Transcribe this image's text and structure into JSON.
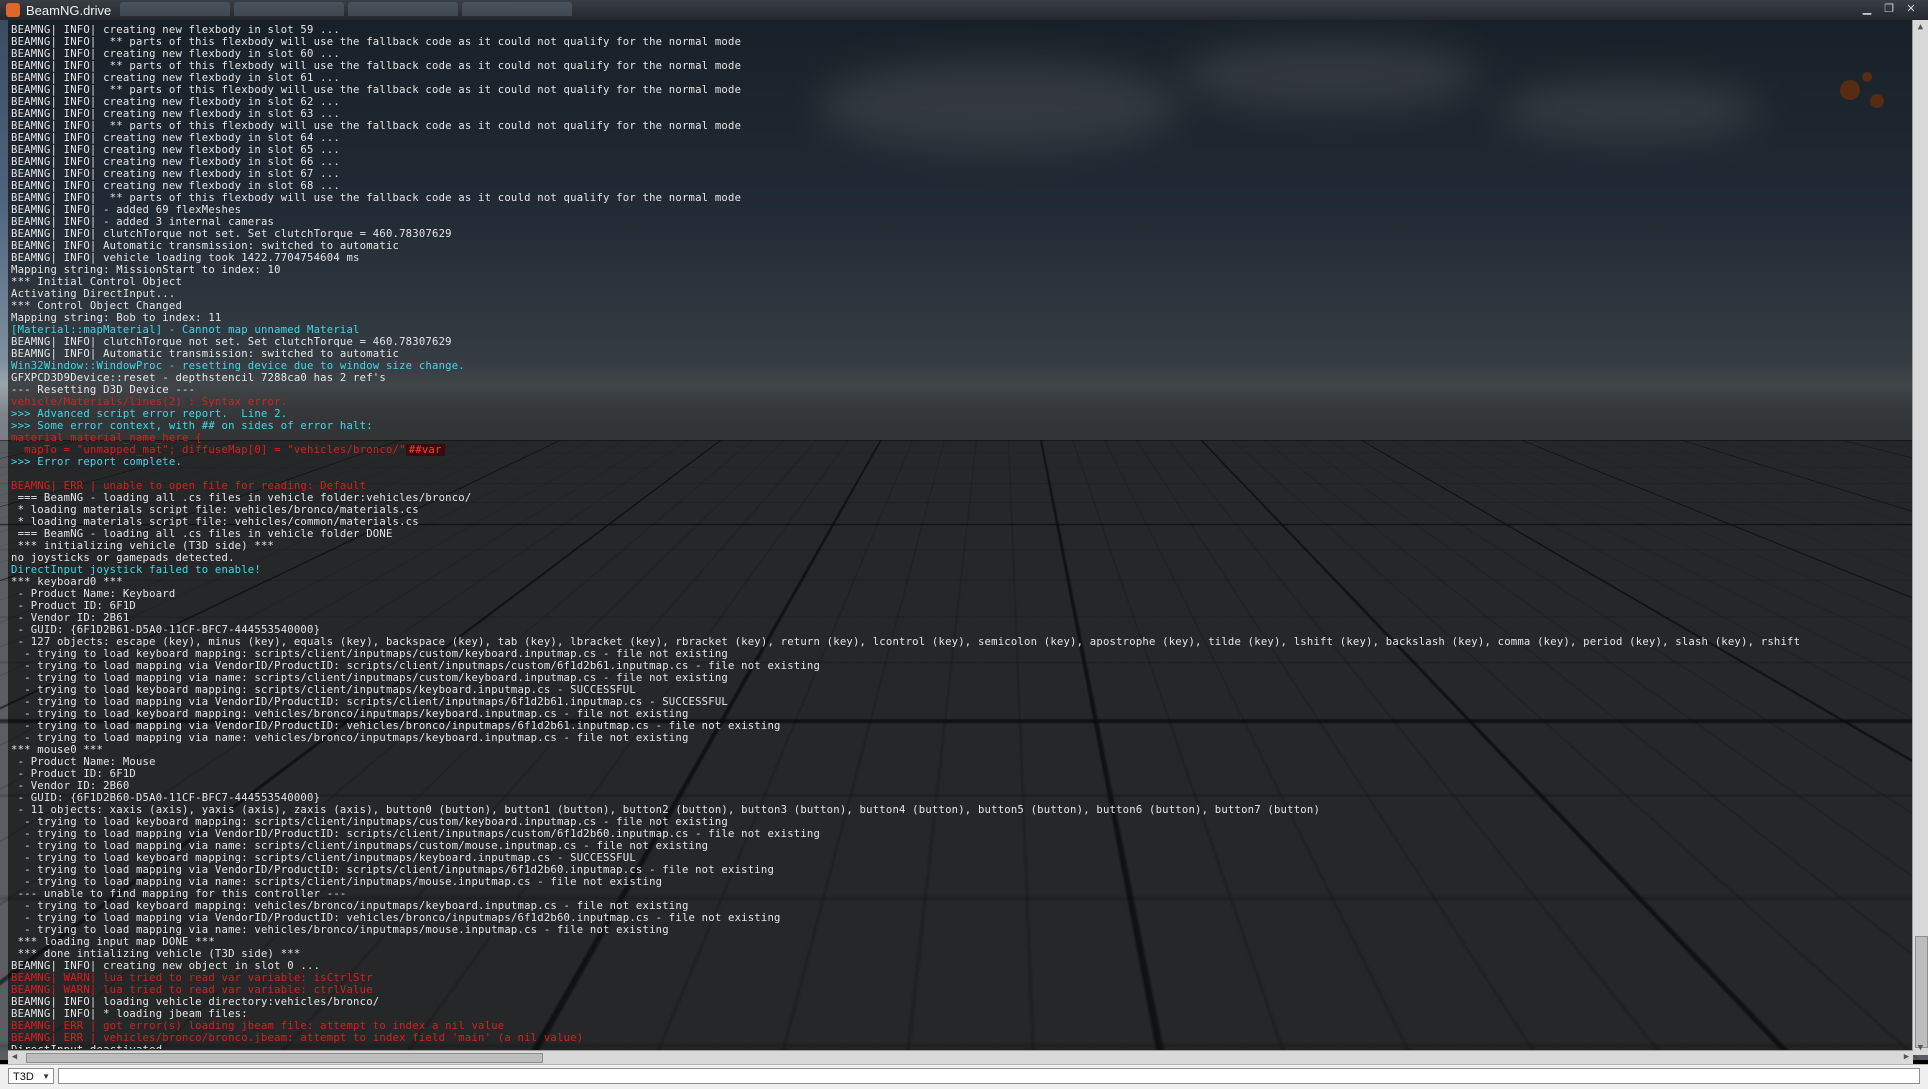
{
  "window": {
    "title": "BeamNG.drive"
  },
  "console": {
    "lines": [
      {
        "cls": "info",
        "text": "BEAMNG| INFO| creating new flexbody in slot 59 ..."
      },
      {
        "cls": "info",
        "text": "BEAMNG| INFO|  ** parts of this flexbody will use the fallback code as it could not qualify for the normal mode"
      },
      {
        "cls": "info",
        "text": "BEAMNG| INFO| creating new flexbody in slot 60 ..."
      },
      {
        "cls": "info",
        "text": "BEAMNG| INFO|  ** parts of this flexbody will use the fallback code as it could not qualify for the normal mode"
      },
      {
        "cls": "info",
        "text": "BEAMNG| INFO| creating new flexbody in slot 61 ..."
      },
      {
        "cls": "info",
        "text": "BEAMNG| INFO|  ** parts of this flexbody will use the fallback code as it could not qualify for the normal mode"
      },
      {
        "cls": "info",
        "text": "BEAMNG| INFO| creating new flexbody in slot 62 ..."
      },
      {
        "cls": "info",
        "text": "BEAMNG| INFO| creating new flexbody in slot 63 ..."
      },
      {
        "cls": "info",
        "text": "BEAMNG| INFO|  ** parts of this flexbody will use the fallback code as it could not qualify for the normal mode"
      },
      {
        "cls": "info",
        "text": "BEAMNG| INFO| creating new flexbody in slot 64 ..."
      },
      {
        "cls": "info",
        "text": "BEAMNG| INFO| creating new flexbody in slot 65 ..."
      },
      {
        "cls": "info",
        "text": "BEAMNG| INFO| creating new flexbody in slot 66 ..."
      },
      {
        "cls": "info",
        "text": "BEAMNG| INFO| creating new flexbody in slot 67 ..."
      },
      {
        "cls": "info",
        "text": "BEAMNG| INFO| creating new flexbody in slot 68 ..."
      },
      {
        "cls": "info",
        "text": "BEAMNG| INFO|  ** parts of this flexbody will use the fallback code as it could not qualify for the normal mode"
      },
      {
        "cls": "info",
        "text": "BEAMNG| INFO| - added 69 flexMeshes"
      },
      {
        "cls": "info",
        "text": "BEAMNG| INFO| - added 3 internal cameras"
      },
      {
        "cls": "info",
        "text": "BEAMNG| INFO| clutchTorque not set. Set clutchTorque = 460.78307629"
      },
      {
        "cls": "info",
        "text": "BEAMNG| INFO| Automatic transmission: switched to automatic"
      },
      {
        "cls": "info",
        "text": "BEAMNG| INFO| vehicle loading took 1422.7704754604 ms"
      },
      {
        "cls": "info",
        "text": "Mapping string: MissionStart to index: 10"
      },
      {
        "cls": "info",
        "text": "*** Initial Control Object"
      },
      {
        "cls": "info",
        "text": "Activating DirectInput..."
      },
      {
        "cls": "info",
        "text": "*** Control Object Changed"
      },
      {
        "cls": "info",
        "text": "Mapping string: Bob to index: 11"
      },
      {
        "cls": "cyan",
        "text": "[Material::mapMaterial] - Cannot map unnamed Material"
      },
      {
        "cls": "info",
        "text": "BEAMNG| INFO| clutchTorque not set. Set clutchTorque = 460.78307629"
      },
      {
        "cls": "info",
        "text": "BEAMNG| INFO| Automatic transmission: switched to automatic"
      },
      {
        "cls": "cyan",
        "text": "Win32Window::WindowProc - resetting device due to window size change."
      },
      {
        "cls": "info",
        "text": "GFXPCD3D9Device::reset - depthstencil 7288ca0 has 2 ref's"
      },
      {
        "cls": "info",
        "text": "--- Resetting D3D Device ---"
      },
      {
        "cls": "red",
        "text": "vehicle/Materials/lines(2) : Syntax error."
      },
      {
        "cls": "cyan",
        "text": ">>> Advanced script error report.  Line 2."
      },
      {
        "cls": "cyan",
        "text": ">>> Some error context, with ## on sides of error halt:"
      },
      {
        "cls": "red",
        "text": "material material_name_here {"
      },
      {
        "cls": "red",
        "text": "  mapTo = \"unmapped_mat\"; diffuseMap[0] = \"vehicles/bronco/\"",
        "hl": "##var"
      },
      {
        "cls": "cyan",
        "text": ">>> Error report complete."
      },
      {
        "cls": "info",
        "text": ""
      },
      {
        "cls": "red",
        "text": "BEAMNG| ERR | unable to open file for reading: Default"
      },
      {
        "cls": "info",
        "text": " === BeamNG - loading all .cs files in vehicle folder:vehicles/bronco/"
      },
      {
        "cls": "info",
        "text": " * loading materials script file: vehicles/bronco/materials.cs"
      },
      {
        "cls": "info",
        "text": " * loading materials script file: vehicles/common/materials.cs"
      },
      {
        "cls": "info",
        "text": " === BeamNG - loading all .cs files in vehicle folder DONE"
      },
      {
        "cls": "info",
        "text": " *** initializing vehicle (T3D side) ***"
      },
      {
        "cls": "info",
        "text": "no joysticks or gamepads detected."
      },
      {
        "cls": "cyan",
        "text": "DirectInput joystick failed to enable!"
      },
      {
        "cls": "info",
        "text": "*** keyboard0 ***"
      },
      {
        "cls": "info",
        "text": " - Product Name: Keyboard"
      },
      {
        "cls": "info",
        "text": " - Product ID: 6F1D"
      },
      {
        "cls": "info",
        "text": " - Vendor ID: 2B61"
      },
      {
        "cls": "info",
        "text": " - GUID: {6F1D2B61-D5A0-11CF-BFC7-444553540000}"
      },
      {
        "cls": "info",
        "text": " - 127 objects: escape (key), minus (key), equals (key), backspace (key), tab (key), lbracket (key), rbracket (key), return (key), lcontrol (key), semicolon (key), apostrophe (key), tilde (key), lshift (key), backslash (key), comma (key), period (key), slash (key), rshift"
      },
      {
        "cls": "info",
        "text": "  - trying to load keyboard mapping: scripts/client/inputmaps/custom/keyboard.inputmap.cs - file not existing"
      },
      {
        "cls": "info",
        "text": "  - trying to load mapping via VendorID/ProductID: scripts/client/inputmaps/custom/6f1d2b61.inputmap.cs - file not existing"
      },
      {
        "cls": "info",
        "text": "  - trying to load mapping via name: scripts/client/inputmaps/custom/keyboard.inputmap.cs - file not existing"
      },
      {
        "cls": "info",
        "text": "  - trying to load keyboard mapping: scripts/client/inputmaps/keyboard.inputmap.cs - SUCCESSFUL"
      },
      {
        "cls": "info",
        "text": "  - trying to load mapping via VendorID/ProductID: scripts/client/inputmaps/6f1d2b61.inputmap.cs - SUCCESSFUL"
      },
      {
        "cls": "info",
        "text": "  - trying to load keyboard mapping: vehicles/bronco/inputmaps/keyboard.inputmap.cs - file not existing"
      },
      {
        "cls": "info",
        "text": "  - trying to load mapping via VendorID/ProductID: vehicles/bronco/inputmaps/6f1d2b61.inputmap.cs - file not existing"
      },
      {
        "cls": "info",
        "text": "  - trying to load mapping via name: vehicles/bronco/inputmaps/keyboard.inputmap.cs - file not existing"
      },
      {
        "cls": "info",
        "text": "*** mouse0 ***"
      },
      {
        "cls": "info",
        "text": " - Product Name: Mouse"
      },
      {
        "cls": "info",
        "text": " - Product ID: 6F1D"
      },
      {
        "cls": "info",
        "text": " - Vendor ID: 2B60"
      },
      {
        "cls": "info",
        "text": " - GUID: {6F1D2B60-D5A0-11CF-BFC7-444553540000}"
      },
      {
        "cls": "info",
        "text": " - 11 objects: xaxis (axis), yaxis (axis), zaxis (axis), button0 (button), button1 (button), button2 (button), button3 (button), button4 (button), button5 (button), button6 (button), button7 (button)"
      },
      {
        "cls": "info",
        "text": "  - trying to load keyboard mapping: scripts/client/inputmaps/custom/keyboard.inputmap.cs - file not existing"
      },
      {
        "cls": "info",
        "text": "  - trying to load mapping via VendorID/ProductID: scripts/client/inputmaps/custom/6f1d2b60.inputmap.cs - file not existing"
      },
      {
        "cls": "info",
        "text": "  - trying to load mapping via name: scripts/client/inputmaps/custom/mouse.inputmap.cs - file not existing"
      },
      {
        "cls": "info",
        "text": "  - trying to load keyboard mapping: scripts/client/inputmaps/keyboard.inputmap.cs - SUCCESSFUL"
      },
      {
        "cls": "info",
        "text": "  - trying to load mapping via VendorID/ProductID: scripts/client/inputmaps/6f1d2b60.inputmap.cs - file not existing"
      },
      {
        "cls": "info",
        "text": "  - trying to load mapping via name: scripts/client/inputmaps/mouse.inputmap.cs - file not existing"
      },
      {
        "cls": "info",
        "text": " --- unable to find mapping for this controller ---"
      },
      {
        "cls": "info",
        "text": "  - trying to load keyboard mapping: vehicles/bronco/inputmaps/keyboard.inputmap.cs - file not existing"
      },
      {
        "cls": "info",
        "text": "  - trying to load mapping via VendorID/ProductID: vehicles/bronco/inputmaps/6f1d2b60.inputmap.cs - file not existing"
      },
      {
        "cls": "info",
        "text": "  - trying to load mapping via name: vehicles/bronco/inputmaps/mouse.inputmap.cs - file not existing"
      },
      {
        "cls": "info",
        "text": " *** loading input map DONE ***"
      },
      {
        "cls": "info",
        "text": " *** done intializing vehicle (T3D side) ***"
      },
      {
        "cls": "info",
        "text": "BEAMNG| INFO| creating new object in slot 0 ..."
      },
      {
        "cls": "red",
        "text": "BEAMNG| WARN| lua tried to read var variable: isCtrlStr"
      },
      {
        "cls": "red",
        "text": "BEAMNG| WARN| lua tried to read var variable: ctrlValue"
      },
      {
        "cls": "info",
        "text": "BEAMNG| INFO| loading vehicle directory:vehicles/bronco/"
      },
      {
        "cls": "info",
        "text": "BEAMNG| INFO| * loading jbeam files:"
      },
      {
        "cls": "red",
        "text": "BEAMNG| ERR | got error(s) loading jbeam file: attempt to index a nil value"
      },
      {
        "cls": "red",
        "text": "BEAMNG| ERR | vehicles/bronco/bronco.jbeam: attempt to index field 'main' (a nil value)"
      },
      {
        "cls": "info",
        "text": "DirectInput deactivated."
      }
    ]
  },
  "scrollbars": {
    "vertical": {
      "up": "▲",
      "down": "▼"
    },
    "horizontal": {
      "left": "◀",
      "right": "▶"
    }
  },
  "command_bar": {
    "scope_value": "T3D",
    "input_value": ""
  }
}
